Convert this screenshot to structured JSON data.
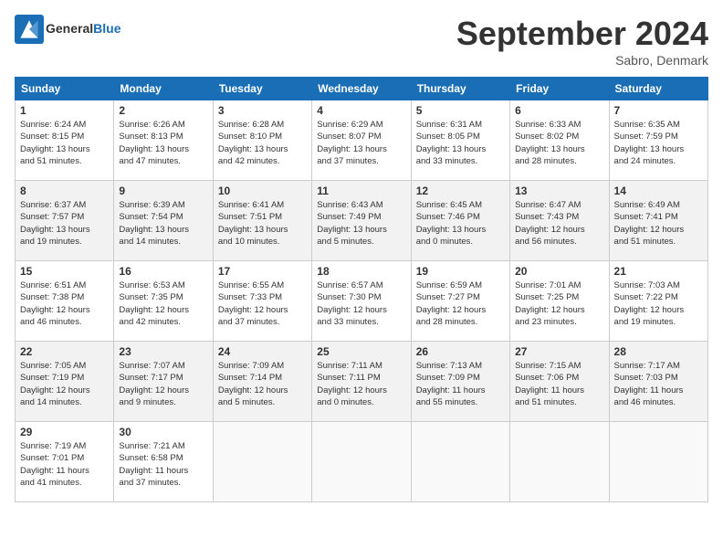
{
  "header": {
    "logo_general": "General",
    "logo_blue": "Blue",
    "month_title": "September 2024",
    "location": "Sabro, Denmark"
  },
  "weekdays": [
    "Sunday",
    "Monday",
    "Tuesday",
    "Wednesday",
    "Thursday",
    "Friday",
    "Saturday"
  ],
  "weeks": [
    [
      {
        "day": "1",
        "info": "Sunrise: 6:24 AM\nSunset: 8:15 PM\nDaylight: 13 hours\nand 51 minutes."
      },
      {
        "day": "2",
        "info": "Sunrise: 6:26 AM\nSunset: 8:13 PM\nDaylight: 13 hours\nand 47 minutes."
      },
      {
        "day": "3",
        "info": "Sunrise: 6:28 AM\nSunset: 8:10 PM\nDaylight: 13 hours\nand 42 minutes."
      },
      {
        "day": "4",
        "info": "Sunrise: 6:29 AM\nSunset: 8:07 PM\nDaylight: 13 hours\nand 37 minutes."
      },
      {
        "day": "5",
        "info": "Sunrise: 6:31 AM\nSunset: 8:05 PM\nDaylight: 13 hours\nand 33 minutes."
      },
      {
        "day": "6",
        "info": "Sunrise: 6:33 AM\nSunset: 8:02 PM\nDaylight: 13 hours\nand 28 minutes."
      },
      {
        "day": "7",
        "info": "Sunrise: 6:35 AM\nSunset: 7:59 PM\nDaylight: 13 hours\nand 24 minutes."
      }
    ],
    [
      {
        "day": "8",
        "info": "Sunrise: 6:37 AM\nSunset: 7:57 PM\nDaylight: 13 hours\nand 19 minutes."
      },
      {
        "day": "9",
        "info": "Sunrise: 6:39 AM\nSunset: 7:54 PM\nDaylight: 13 hours\nand 14 minutes."
      },
      {
        "day": "10",
        "info": "Sunrise: 6:41 AM\nSunset: 7:51 PM\nDaylight: 13 hours\nand 10 minutes."
      },
      {
        "day": "11",
        "info": "Sunrise: 6:43 AM\nSunset: 7:49 PM\nDaylight: 13 hours\nand 5 minutes."
      },
      {
        "day": "12",
        "info": "Sunrise: 6:45 AM\nSunset: 7:46 PM\nDaylight: 13 hours\nand 0 minutes."
      },
      {
        "day": "13",
        "info": "Sunrise: 6:47 AM\nSunset: 7:43 PM\nDaylight: 12 hours\nand 56 minutes."
      },
      {
        "day": "14",
        "info": "Sunrise: 6:49 AM\nSunset: 7:41 PM\nDaylight: 12 hours\nand 51 minutes."
      }
    ],
    [
      {
        "day": "15",
        "info": "Sunrise: 6:51 AM\nSunset: 7:38 PM\nDaylight: 12 hours\nand 46 minutes."
      },
      {
        "day": "16",
        "info": "Sunrise: 6:53 AM\nSunset: 7:35 PM\nDaylight: 12 hours\nand 42 minutes."
      },
      {
        "day": "17",
        "info": "Sunrise: 6:55 AM\nSunset: 7:33 PM\nDaylight: 12 hours\nand 37 minutes."
      },
      {
        "day": "18",
        "info": "Sunrise: 6:57 AM\nSunset: 7:30 PM\nDaylight: 12 hours\nand 33 minutes."
      },
      {
        "day": "19",
        "info": "Sunrise: 6:59 AM\nSunset: 7:27 PM\nDaylight: 12 hours\nand 28 minutes."
      },
      {
        "day": "20",
        "info": "Sunrise: 7:01 AM\nSunset: 7:25 PM\nDaylight: 12 hours\nand 23 minutes."
      },
      {
        "day": "21",
        "info": "Sunrise: 7:03 AM\nSunset: 7:22 PM\nDaylight: 12 hours\nand 19 minutes."
      }
    ],
    [
      {
        "day": "22",
        "info": "Sunrise: 7:05 AM\nSunset: 7:19 PM\nDaylight: 12 hours\nand 14 minutes."
      },
      {
        "day": "23",
        "info": "Sunrise: 7:07 AM\nSunset: 7:17 PM\nDaylight: 12 hours\nand 9 minutes."
      },
      {
        "day": "24",
        "info": "Sunrise: 7:09 AM\nSunset: 7:14 PM\nDaylight: 12 hours\nand 5 minutes."
      },
      {
        "day": "25",
        "info": "Sunrise: 7:11 AM\nSunset: 7:11 PM\nDaylight: 12 hours\nand 0 minutes."
      },
      {
        "day": "26",
        "info": "Sunrise: 7:13 AM\nSunset: 7:09 PM\nDaylight: 11 hours\nand 55 minutes."
      },
      {
        "day": "27",
        "info": "Sunrise: 7:15 AM\nSunset: 7:06 PM\nDaylight: 11 hours\nand 51 minutes."
      },
      {
        "day": "28",
        "info": "Sunrise: 7:17 AM\nSunset: 7:03 PM\nDaylight: 11 hours\nand 46 minutes."
      }
    ],
    [
      {
        "day": "29",
        "info": "Sunrise: 7:19 AM\nSunset: 7:01 PM\nDaylight: 11 hours\nand 41 minutes."
      },
      {
        "day": "30",
        "info": "Sunrise: 7:21 AM\nSunset: 6:58 PM\nDaylight: 11 hours\nand 37 minutes."
      },
      {
        "day": "",
        "info": ""
      },
      {
        "day": "",
        "info": ""
      },
      {
        "day": "",
        "info": ""
      },
      {
        "day": "",
        "info": ""
      },
      {
        "day": "",
        "info": ""
      }
    ]
  ]
}
